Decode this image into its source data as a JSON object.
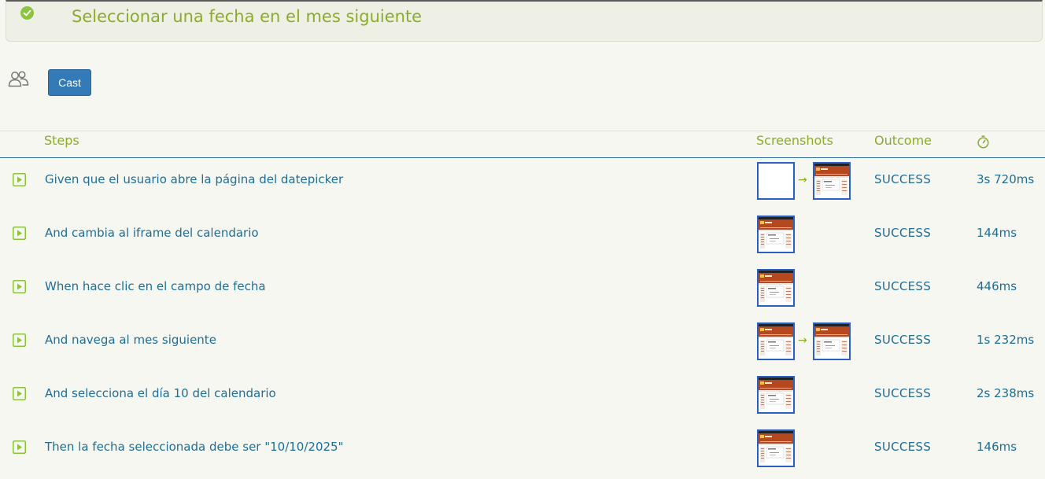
{
  "scenario": {
    "title": "Seleccionar una fecha en el mes siguiente",
    "status_icon": "check-circle-icon",
    "status_color": "#8dc33f"
  },
  "toolbar": {
    "cast_icon": "users-icon",
    "cast_label": "Cast",
    "accent": "#337ab7"
  },
  "table": {
    "headers": {
      "steps": "Steps",
      "screenshots": "Screenshots",
      "outcome": "Outcome",
      "duration_icon": "stopwatch-icon"
    },
    "rows": [
      {
        "step": "Given que el usuario abre la página del datepicker",
        "screenshots": [
          "blank-page",
          "datepicker-page"
        ],
        "outcome": "SUCCESS",
        "duration": "3s 720ms"
      },
      {
        "step": "And cambia al iframe del calendario",
        "screenshots": [
          "datepicker-page"
        ],
        "outcome": "SUCCESS",
        "duration": "144ms"
      },
      {
        "step": "When hace clic en el campo de fecha",
        "screenshots": [
          "datepicker-page"
        ],
        "outcome": "SUCCESS",
        "duration": "446ms"
      },
      {
        "step": "And navega al mes siguiente",
        "screenshots": [
          "datepicker-page",
          "datepicker-page"
        ],
        "outcome": "SUCCESS",
        "duration": "1s 232ms"
      },
      {
        "step": "And selecciona el día 10 del calendario",
        "screenshots": [
          "datepicker-page"
        ],
        "outcome": "SUCCESS",
        "duration": "2s 238ms"
      },
      {
        "step": "Then la fecha seleccionada debe ser \"10/10/2025\"",
        "screenshots": [
          "datepicker-page"
        ],
        "outcome": "SUCCESS",
        "duration": "146ms"
      }
    ]
  },
  "colors": {
    "step_text": "#1f6e97",
    "header_text": "#8aac28",
    "thumb_border": "#2b5fc4",
    "thumb_banner": "#b5481f"
  }
}
